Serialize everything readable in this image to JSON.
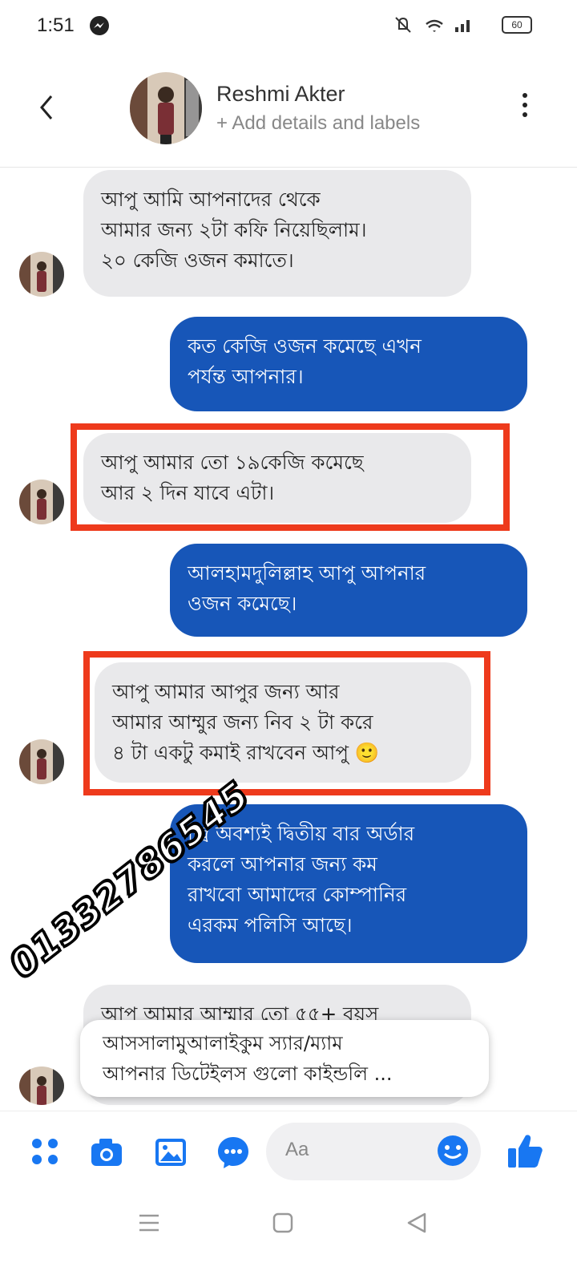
{
  "status_bar": {
    "time": "1:51",
    "icons_text": "🔕 ᯤ ıll",
    "battery": "60"
  },
  "header": {
    "name": "Reshmi Akter",
    "subtitle": "+ Add details and labels"
  },
  "messages": [
    {
      "side": "in",
      "text": "আপু আমি আপনাদের থেকে\nআমার জন্য ২টা কফি নিয়েছিলাম।\n২০ কেজি ওজন কমাতে।"
    },
    {
      "side": "out",
      "text": "কত কেজি ওজন কমেছে এখন\nপর্যন্ত আপনার।"
    },
    {
      "side": "in",
      "text": "আপু আমার তো ১৯কেজি কমেছে\nআর ২ দিন যাবে এটা।"
    },
    {
      "side": "out",
      "text": "আলহামদুলিল্লাহ আপু আপনার\nওজন কমেছে।"
    },
    {
      "side": "in",
      "text": "আপু আমার আপুর জন্য আর\nআমার আম্মুর জন্য নিব ২ টা করে\n৪ টা একটু কমাই রাখবেন আপু 🙂"
    },
    {
      "side": "out",
      "text": "জ্বি অবশ্যই দ্বিতীয় বার অর্ডার\nকরলে আপনার জন্য কম\nরাখবো আমাদের কোম্পানির\nএরকম পলিসি আছে।"
    },
    {
      "side": "in",
      "text": "আপু আমার আম্মার তো ৫৫+ বয়স"
    }
  ],
  "overlay_phone": "01332786545",
  "quick_reply": "আসসালামুআলাইকুম স্যার/ম্যাম\nআপনার ডিটেইলস গুলো কাইন্ডলি ...",
  "compose": {
    "placeholder": "Aa"
  },
  "colors": {
    "outgoing_bubble": "#1756b8",
    "incoming_bubble": "#e9e9eb",
    "highlight_box": "#ee3a1c",
    "accent": "#1877f2"
  },
  "icons": [
    "back-icon",
    "more-icon",
    "apps-icon",
    "camera-icon",
    "gallery-icon",
    "chat-bubble-icon",
    "emoji-icon",
    "thumbs-up-icon",
    "menu-icon",
    "home-icon",
    "back-nav-icon"
  ]
}
